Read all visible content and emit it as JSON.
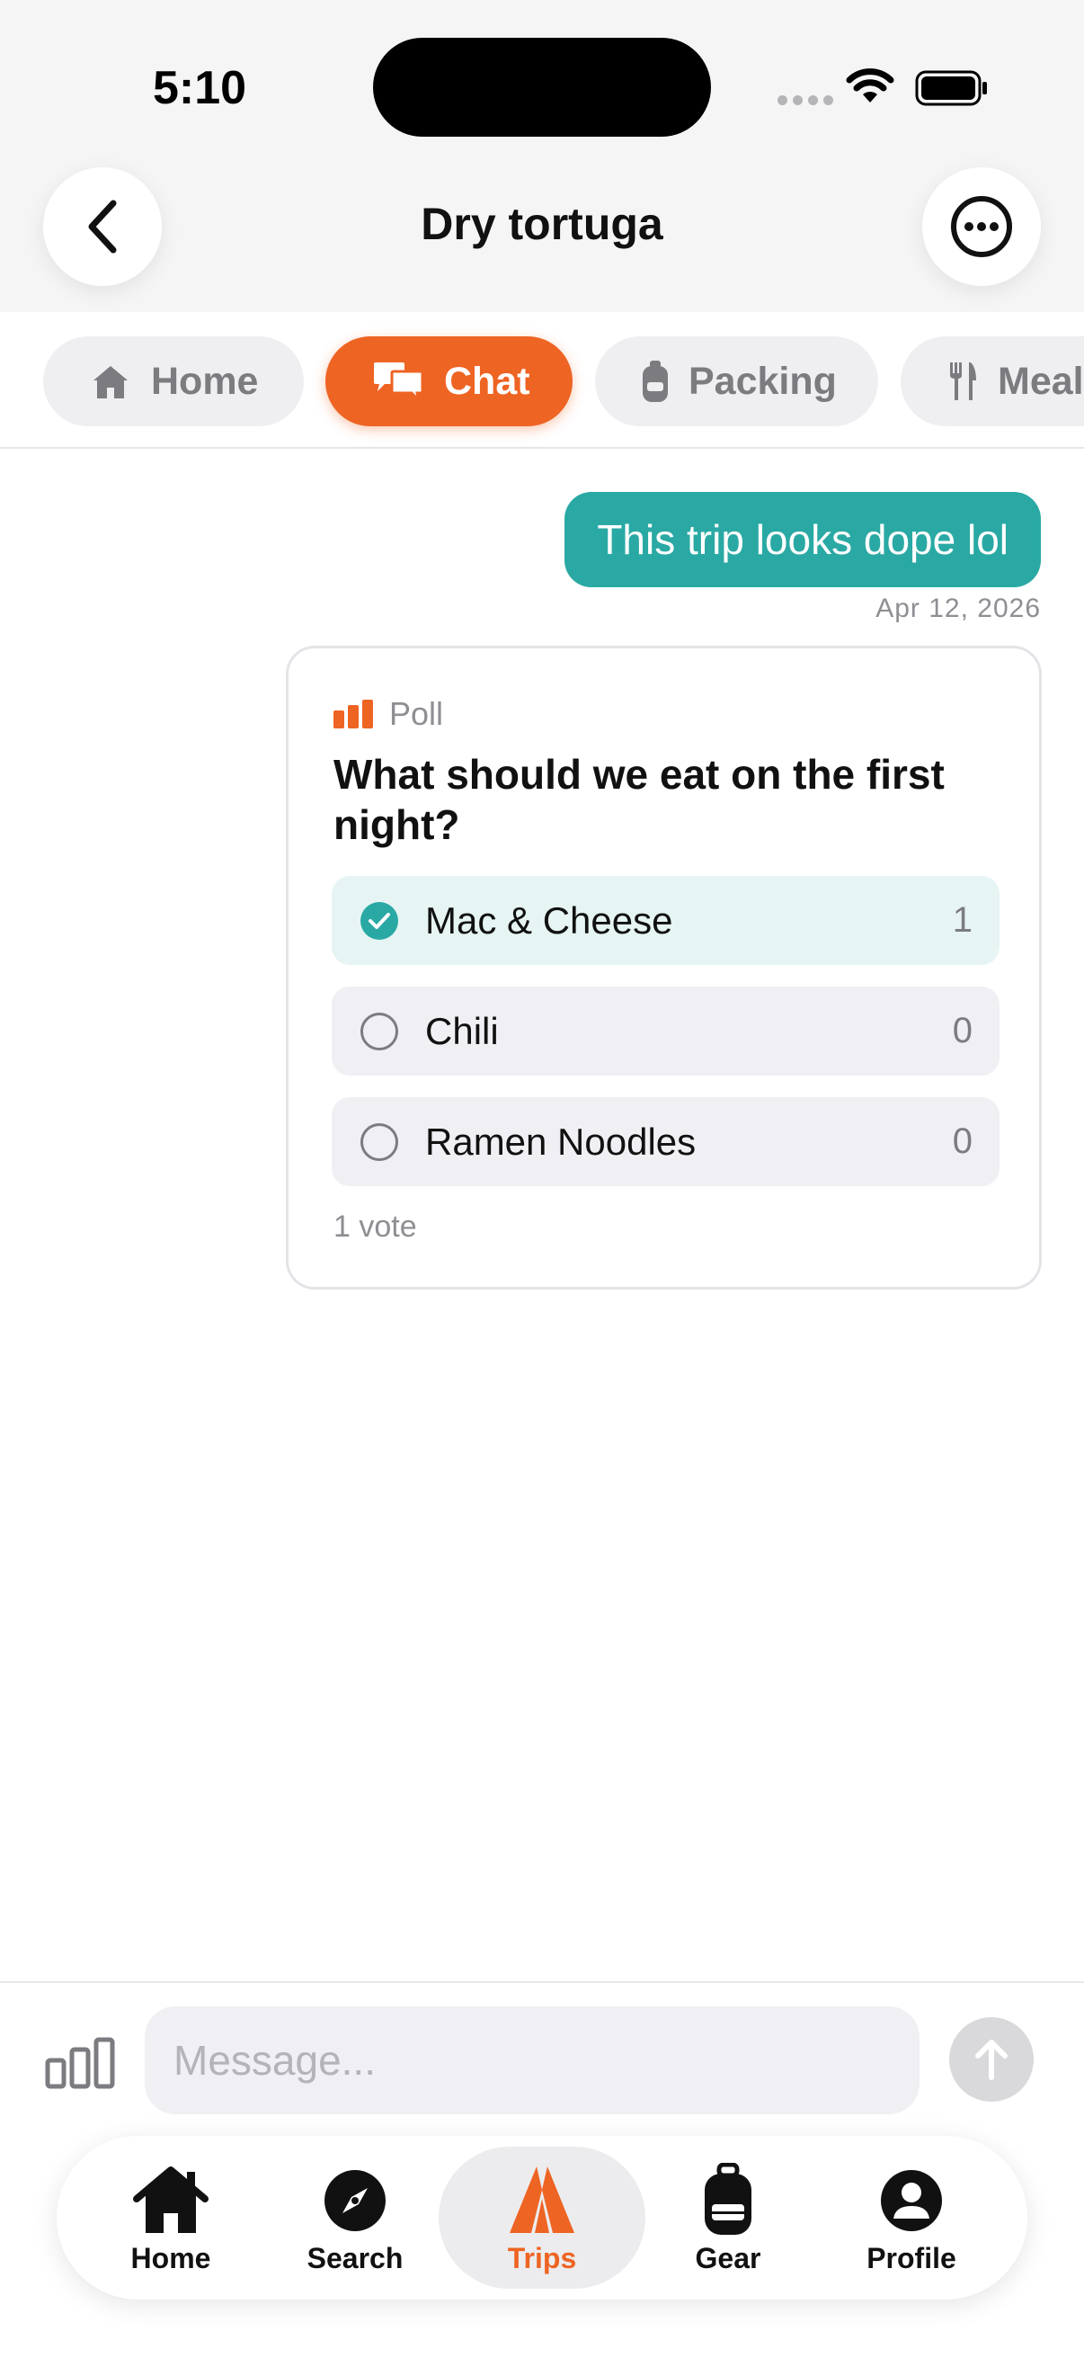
{
  "status_bar": {
    "time": "5:10"
  },
  "header": {
    "title": "Dry tortuga",
    "back_icon": "chevron-left-icon",
    "more_icon": "ellipsis-circle-icon"
  },
  "tabs": [
    {
      "label": "Home",
      "icon": "house-icon",
      "active": false
    },
    {
      "label": "Chat",
      "icon": "chat-bubbles-icon",
      "active": true
    },
    {
      "label": "Packing",
      "icon": "backpack-icon",
      "active": false
    },
    {
      "label": "Meals",
      "icon": "fork-knife-icon",
      "active": false
    }
  ],
  "messages": [
    {
      "text": "This trip looks dope lol",
      "timestamp": "Apr 12, 2026"
    }
  ],
  "poll": {
    "tag": "Poll",
    "question": "What should we eat on the first night?",
    "options": [
      {
        "label": "Mac & Cheese",
        "count": "1",
        "selected": true
      },
      {
        "label": "Chili",
        "count": "0",
        "selected": false
      },
      {
        "label": "Ramen Noodles",
        "count": "0",
        "selected": false
      }
    ],
    "vote_summary": "1 vote"
  },
  "composer": {
    "placeholder": "Message..."
  },
  "tab_bar": [
    {
      "label": "Home",
      "icon": "home-icon",
      "active": false
    },
    {
      "label": "Search",
      "icon": "compass-icon",
      "active": false
    },
    {
      "label": "Trips",
      "icon": "tent-icon",
      "active": true
    },
    {
      "label": "Gear",
      "icon": "backpack-icon",
      "active": false
    },
    {
      "label": "Profile",
      "icon": "person-icon",
      "active": false
    }
  ],
  "colors": {
    "accent": "#ee6423",
    "teal": "#2aa9a4"
  }
}
